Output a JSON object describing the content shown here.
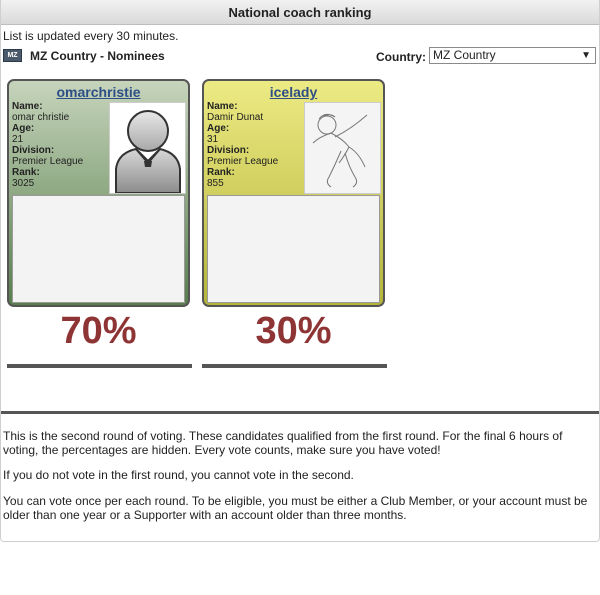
{
  "header": {
    "title": "National coach ranking"
  },
  "notice": "List is updated every 30 minutes.",
  "section": {
    "badge": "MZ",
    "title": "MZ Country - Nominees"
  },
  "country_filter": {
    "label": "Country:",
    "selected": "MZ Country"
  },
  "labels": {
    "name": "Name:",
    "age": "Age:",
    "division": "Division:",
    "rank": "Rank:"
  },
  "nominees": [
    {
      "username": "omarchristie",
      "name": "omar christie",
      "age": "21",
      "division": "Premier League",
      "rank": "3025",
      "percentage": "70%",
      "theme": "#577e4c"
    },
    {
      "username": "icelady",
      "name": "Damir Dunat",
      "age": "31",
      "division": "Premier League",
      "rank": "855",
      "percentage": "30%",
      "theme": "#b5b43a"
    }
  ],
  "info": [
    "This is the second round of voting. These candidates qualified from the first round. For the final 6 hours of voting, the percentages are hidden. Every vote counts, make sure you have voted!",
    "If you do not vote in the first round, you cannot vote in the second.",
    "You can vote once per each round. To be eligible, you must be either a Club Member, or your account must be older than one year or a Supporter with an account older than three months."
  ]
}
